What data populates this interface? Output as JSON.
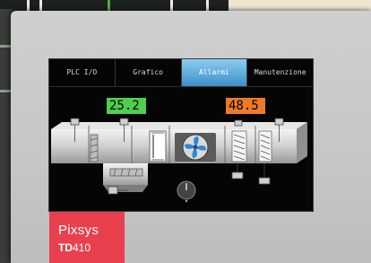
{
  "screen": {
    "tabs": [
      {
        "label": "PLC I/O",
        "active": false
      },
      {
        "label": "Grafico",
        "active": false
      },
      {
        "label": "Allarmi",
        "active": true
      },
      {
        "label": "Manutenzione",
        "active": false
      }
    ],
    "readouts": {
      "green": "25.2",
      "orange": "48.5"
    }
  },
  "device": {
    "brand": "Pixsys",
    "model_prefix": "TD",
    "model_number": "410"
  },
  "colors": {
    "accent_tab": "#4aa3dd",
    "readout_green": "#4fce4f",
    "readout_orange": "#ee7a28",
    "brand_red": "#e8404d"
  },
  "icons": [
    "fan-icon",
    "damper-icon",
    "filter-icon",
    "coil-icon",
    "sensor-icon",
    "valve-icon",
    "knob-icon"
  ]
}
